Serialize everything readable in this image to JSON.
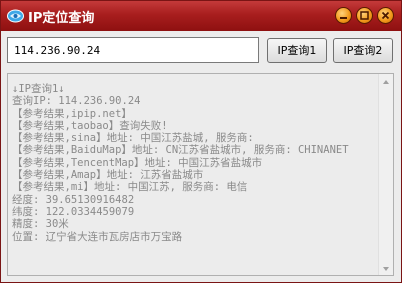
{
  "window": {
    "title": "IP定位查询"
  },
  "input": {
    "value": "114.236.90.24"
  },
  "buttons": {
    "query1": "IP查询1",
    "query2": "IP查询2"
  },
  "output": {
    "lines": [
      "↓IP查询1↓",
      "查询IP: 114.236.90.24",
      "【参考结果,ipip.net】",
      "【参考结果,taobao】查询失败!",
      "【参考结果,sina】地址: 中国江苏盐城, 服务商:",
      "【参考结果,BaiduMap】地址: CN江苏省盐城市, 服务商: CHINANET",
      "【参考结果,TencentMap】地址: 中国江苏省盐城市",
      "【参考结果,Amap】地址: 江苏省盐城市",
      "【参考结果,mi】地址: 中国江苏, 服务商: 电信",
      "经度: 39.65130916482",
      "纬度: 122.0334459079",
      "精度: 30米",
      "位置: 辽宁省大连市瓦房店市万宝路"
    ]
  }
}
